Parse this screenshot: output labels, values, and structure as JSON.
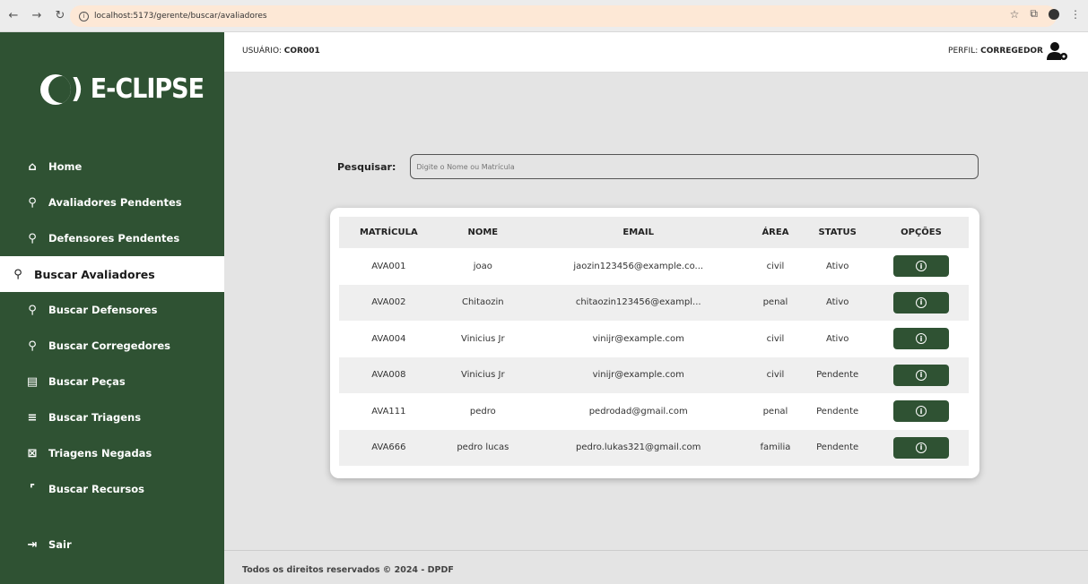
{
  "browser": {
    "url": "localhost:5173/gerente/buscar/avaliadores"
  },
  "logo": {
    "paren": ")",
    "brand": "E-CLIPSE"
  },
  "sidebar": {
    "items": [
      {
        "label": "Home",
        "icon": "home-icon",
        "glyph": "⌂"
      },
      {
        "label": "Avaliadores Pendentes",
        "icon": "user-pending-icon",
        "glyph": "⚲"
      },
      {
        "label": "Defensores Pendentes",
        "icon": "user-pending-icon",
        "glyph": "⚲"
      },
      {
        "label": "Buscar Avaliadores",
        "icon": "user-search-icon",
        "glyph": "⚲"
      },
      {
        "label": "Buscar Defensores",
        "icon": "user-search-icon",
        "glyph": "⚲"
      },
      {
        "label": "Buscar Corregedores",
        "icon": "user-search-icon",
        "glyph": "⚲"
      },
      {
        "label": "Buscar Peças",
        "icon": "document-search-icon",
        "glyph": "▤"
      },
      {
        "label": "Buscar Triagens",
        "icon": "list-search-icon",
        "glyph": "≡"
      },
      {
        "label": "Triagens Negadas",
        "icon": "archive-denied-icon",
        "glyph": "⊠"
      },
      {
        "label": "Buscar Recursos",
        "icon": "scan-search-icon",
        "glyph": "⌜"
      }
    ],
    "exit_label": "Sair",
    "exit_glyph": "⇥"
  },
  "header": {
    "user_prefix": "USUÁRIO:",
    "user_value": "COR001",
    "profile_prefix": "PERFIL:",
    "profile_value": "CORREGEDOR"
  },
  "search": {
    "label": "Pesquisar:",
    "placeholder": "Digite o Nome ou Matrícula"
  },
  "table": {
    "headers": [
      "MATRÍCULA",
      "NOME",
      "EMAIL",
      "ÁREA",
      "STATUS",
      "OPÇÕES"
    ],
    "rows": [
      [
        "AVA001",
        "joao",
        "jaozin123456@example.co...",
        "civil",
        "Ativo"
      ],
      [
        "AVA002",
        "Chitaozin",
        "chitaozin123456@exampl...",
        "penal",
        "Ativo"
      ],
      [
        "AVA004",
        "Vinicius Jr",
        "vinijr@example.com",
        "civil",
        "Ativo"
      ],
      [
        "AVA008",
        "Vinicius Jr",
        "vinijr@example.com",
        "civil",
        "Pendente"
      ],
      [
        "AVA111",
        "pedro",
        "pedrodad@gmail.com",
        "penal",
        "Pendente"
      ],
      [
        "AVA666",
        "pedro lucas",
        "pedro.lukas321@gmail.com",
        "familia",
        "Pendente"
      ]
    ]
  },
  "footer": {
    "text": "Todos os direitos reservados © 2024 - DPDF"
  },
  "colors": {
    "brand_green": "#2f5233",
    "background": "#e4e4e4"
  }
}
